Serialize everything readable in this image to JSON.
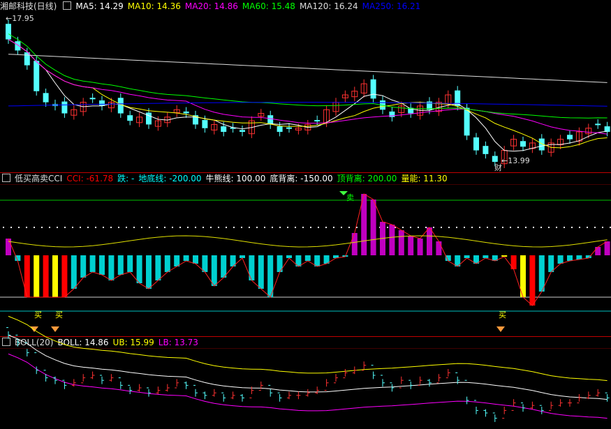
{
  "panel1": {
    "title": "湘邮科技(日线)",
    "ma": [
      {
        "label": "MA5: 14.29",
        "color": "#ffffff"
      },
      {
        "label": "MA10: 14.36",
        "color": "#ffff00"
      },
      {
        "label": "MA20: 14.86",
        "color": "#ff00ff"
      },
      {
        "label": "MA60: 15.48",
        "color": "#00ff00"
      },
      {
        "label": "MA120: 16.24",
        "color": "#dddddd"
      },
      {
        "label": "MA250: 16.21",
        "color": "#0000ff"
      }
    ],
    "high_label": "17.95",
    "low_label": "13.99",
    "marker": "财"
  },
  "panel2": {
    "title": "低买高卖CCI",
    "items": [
      {
        "label": "CCI: -61.78",
        "color": "#ff0000"
      },
      {
        "label": "跌: -",
        "color": "#00ffff"
      },
      {
        "label": "地底线: -200.00",
        "color": "#00ffff"
      },
      {
        "label": "牛熊线: 100.00",
        "color": "#ffffff"
      },
      {
        "label": "底背离: -150.00",
        "color": "#ffffff"
      },
      {
        "label": "顶背离: 200.00",
        "color": "#00ff00"
      },
      {
        "label": "量能: 11.30",
        "color": "#ffff00"
      }
    ],
    "buy_label": "买",
    "sell_label": "卖"
  },
  "panel3": {
    "title": "BOLL(20)",
    "items": [
      {
        "label": "BOLL: 14.86",
        "color": "#ffffff"
      },
      {
        "label": "UB: 15.99",
        "color": "#ffff00"
      },
      {
        "label": "LB: 13.73",
        "color": "#ff00ff"
      }
    ]
  },
  "colors": {
    "up": "#ff3232",
    "down": "#54ffff",
    "border": "#8b0000"
  }
}
